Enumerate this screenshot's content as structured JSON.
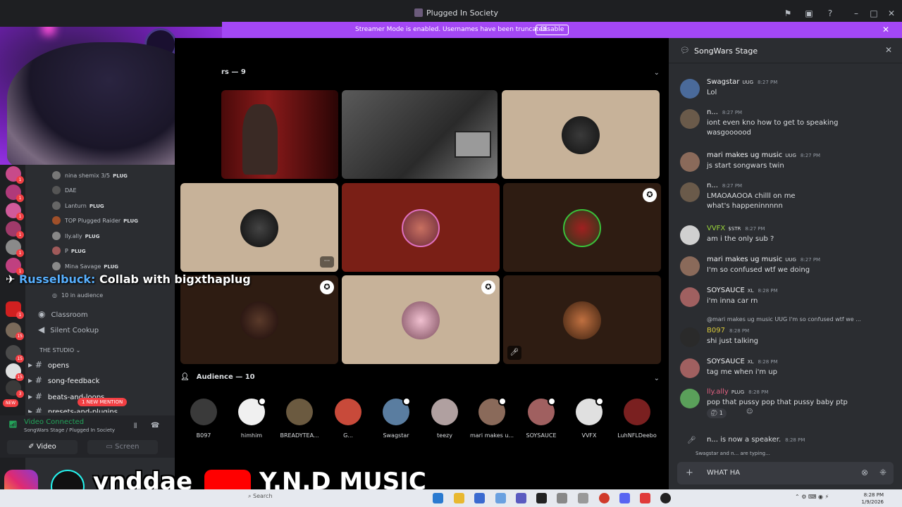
{
  "window": {
    "title": "Plugged In Society"
  },
  "banner": {
    "message": "Streamer Mode is enabled. Usernames have been truncated.",
    "disable_label": "Disable"
  },
  "stage": {
    "speakers_header": "rs — 9",
    "audience_header": "Audience — 10",
    "audience": [
      {
        "name": "B097",
        "color": "#3a3a3a"
      },
      {
        "name": "himhim",
        "color": "#f0f0f0"
      },
      {
        "name": "BREADYTEA...",
        "color": "#6b5a40"
      },
      {
        "name": "G...",
        "color": "#c84a3a"
      },
      {
        "name": "Swagstar",
        "color": "#5a7da0"
      },
      {
        "name": "teezy",
        "color": "#b0a0a0"
      },
      {
        "name": "mari makes u...",
        "color": "#8a6a5a"
      },
      {
        "name": "SOYSAUCE",
        "color": "#a06060"
      },
      {
        "name": "VVFX",
        "color": "#e0e0e0"
      },
      {
        "name": "LuhNFLDeebo",
        "color": "#7a2020"
      }
    ]
  },
  "sidebar": {
    "members": [
      {
        "name": "nina shemix 3/5",
        "tag": "PLUG"
      },
      {
        "name": "DAE",
        "tag": ""
      },
      {
        "name": "Lanturn",
        "tag": "PLUG"
      },
      {
        "name": "TOP Plugged Raider",
        "tag": "PLUG"
      },
      {
        "name": "lly.ally",
        "tag": "PLUG"
      },
      {
        "name": "P",
        "tag": "PLUG"
      },
      {
        "name": "Mina Savage",
        "tag": "PLUG"
      }
    ],
    "audience_count": "10 in audience",
    "voice_channels": [
      "Classroom",
      "Silent Cookup"
    ],
    "category": "THE STUDIO",
    "text_channels": [
      "opens",
      "song-feedback",
      "beats-and-loops",
      "presets-and-plugins"
    ],
    "mention_badge": "1 NEW MENTION",
    "new_badge": "NEW",
    "server_badges": [
      "1",
      "1",
      "1",
      "1",
      "1",
      "1",
      "1",
      "15",
      "15",
      "15",
      "3"
    ]
  },
  "overlay": {
    "who": "Russelbuck:",
    "text": "Collab with bigxthaplug"
  },
  "voice": {
    "status": "Video Connected",
    "location": "SongWars Stage / Plugged In Society",
    "video_label": "Video",
    "screen_label": "Screen"
  },
  "chat": {
    "title": "SongWars Stage",
    "messages": [
      {
        "name": "Swagstar",
        "tag": "UUG",
        "time": "8:27 PM",
        "lines": [
          "Lol"
        ],
        "color": "#4a6a9a"
      },
      {
        "name": "n...",
        "tag": "",
        "time": "8:27 PM",
        "lines": [
          "iont even kno how to get to speaking",
          "wasgoooood"
        ],
        "color": "#6a5a4a"
      },
      {
        "name": "mari makes ug music",
        "tag": "UUG",
        "time": "8:27 PM",
        "lines": [
          "js start songwars twin"
        ],
        "color": "#8a6a5a"
      },
      {
        "name": "n...",
        "tag": "",
        "time": "8:27 PM",
        "lines": [
          "LMAOAAOOA chilll on me",
          "what's happeninnnnn"
        ],
        "color": "#6a5a4a"
      },
      {
        "name": "VVFX",
        "tag": "$STR",
        "time": "8:27 PM",
        "lines": [
          "am i the only sub ?"
        ],
        "color": "#d0d0d0"
      },
      {
        "name": "mari makes ug music",
        "tag": "UUG",
        "time": "8:27 PM",
        "lines": [
          "I'm so confused wtf we doing"
        ],
        "color": "#8a6a5a"
      },
      {
        "name": "SOYSAUCE",
        "tag": "XL",
        "time": "8:28 PM",
        "lines": [
          "i'm inna car rn"
        ],
        "color": "#a06060"
      },
      {
        "name": "B097",
        "tag": "",
        "time": "8:28 PM",
        "lines": [
          "shi just talking"
        ],
        "color": "#2a2a2a"
      },
      {
        "name": "SOYSAUCE",
        "tag": "XL",
        "time": "8:28 PM",
        "lines": [
          "tag me when i'm up"
        ],
        "color": "#a06060"
      },
      {
        "name": "lly.ally",
        "tag": "PLUG",
        "time": "8:28 PM",
        "lines": [
          "pop that pussy pop that pussy baby ptp"
        ],
        "color": "#5aa05a"
      }
    ],
    "reply_preview": "@mari makes ug music  UUG  I'm so confused wtf we ...",
    "reaction_count": "1",
    "system_name": "n...",
    "system_text": "is now a speaker.",
    "system_time": "8:28 PM",
    "typing": "Swagstar and n... are typing...",
    "input_value": "WHAT HA"
  },
  "socials": {
    "tiktok": "ynddae",
    "youtube": "Y.N.D MUSIC"
  },
  "taskbar": {
    "search": "Search",
    "time": "8:28 PM",
    "date": "1/9/2026"
  }
}
